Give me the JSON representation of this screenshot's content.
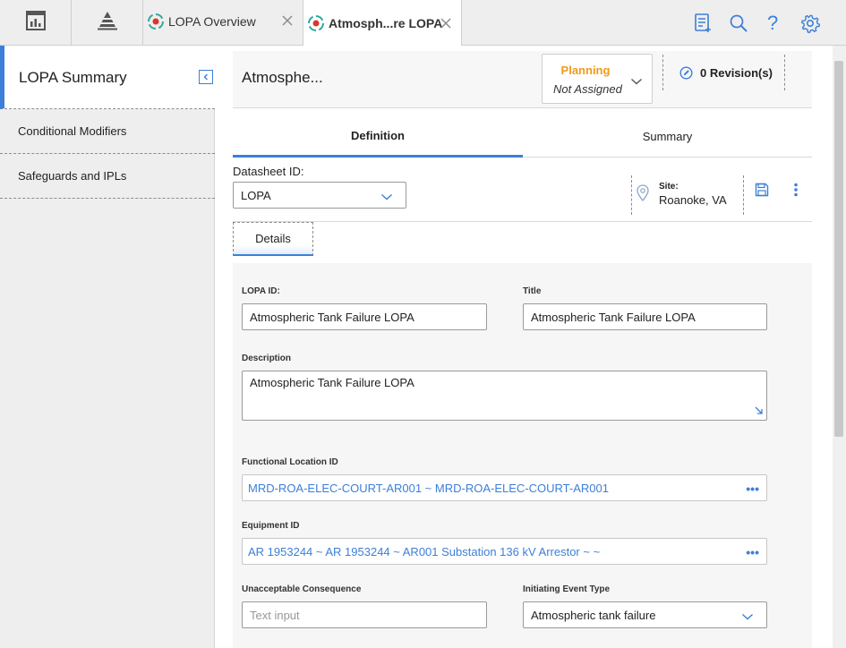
{
  "topbar": {
    "left_icons": [
      "dashboard-icon",
      "pyramid-icon"
    ],
    "tabs": [
      {
        "label": "LOPA Overview",
        "icon": "lopa-target-icon",
        "active": false
      },
      {
        "label": "Atmosph...re LOPA",
        "icon": "lopa-target-icon",
        "active": true
      }
    ],
    "right_icons": [
      "checklist-add-icon",
      "search-icon",
      "help-icon",
      "gear-icon"
    ],
    "help_glyph": "?"
  },
  "sidebar": {
    "title": "LOPA Summary",
    "items": [
      {
        "label": "Conditional Modifiers"
      },
      {
        "label": "Safeguards and IPLs"
      }
    ]
  },
  "header": {
    "title": "Atmosphe...",
    "state": {
      "label": "Planning",
      "assignee": "Not Assigned"
    },
    "revisions": "0 Revision(s)"
  },
  "tabs": [
    {
      "label": "Definition",
      "active": true
    },
    {
      "label": "Summary",
      "active": false
    }
  ],
  "datasheet": {
    "label": "Datasheet ID:",
    "value": "LOPA"
  },
  "site": {
    "label": "Site:",
    "value": "Roanoke, VA"
  },
  "subtab": {
    "label": "Details"
  },
  "form": {
    "lopa_id": {
      "label": "LOPA ID:",
      "value": "Atmospheric Tank Failure LOPA"
    },
    "title": {
      "label": "Title",
      "value": "Atmospheric Tank Failure LOPA"
    },
    "description": {
      "label": "Description",
      "value": "Atmospheric Tank Failure LOPA"
    },
    "functional_location": {
      "label": "Functional Location ID",
      "value": "MRD-ROA-ELEC-COURT-AR001 ~ MRD-ROA-ELEC-COURT-AR001"
    },
    "equipment": {
      "label": "Equipment ID",
      "value": "AR 1953244 ~ AR 1953244 ~ AR001 Substation 136 kV Arrestor ~ ~"
    },
    "unacceptable_consequence": {
      "label": "Unacceptable Consequence",
      "placeholder": "Text input"
    },
    "initiating_event_type": {
      "label": "Initiating Event Type",
      "value": "Atmospheric tank failure"
    }
  },
  "colors": {
    "accent": "#3d7fd8",
    "planning": "#f09a1a",
    "lopa_icon_red": "#e0342a",
    "lopa_icon_teal": "#2aa89a"
  }
}
